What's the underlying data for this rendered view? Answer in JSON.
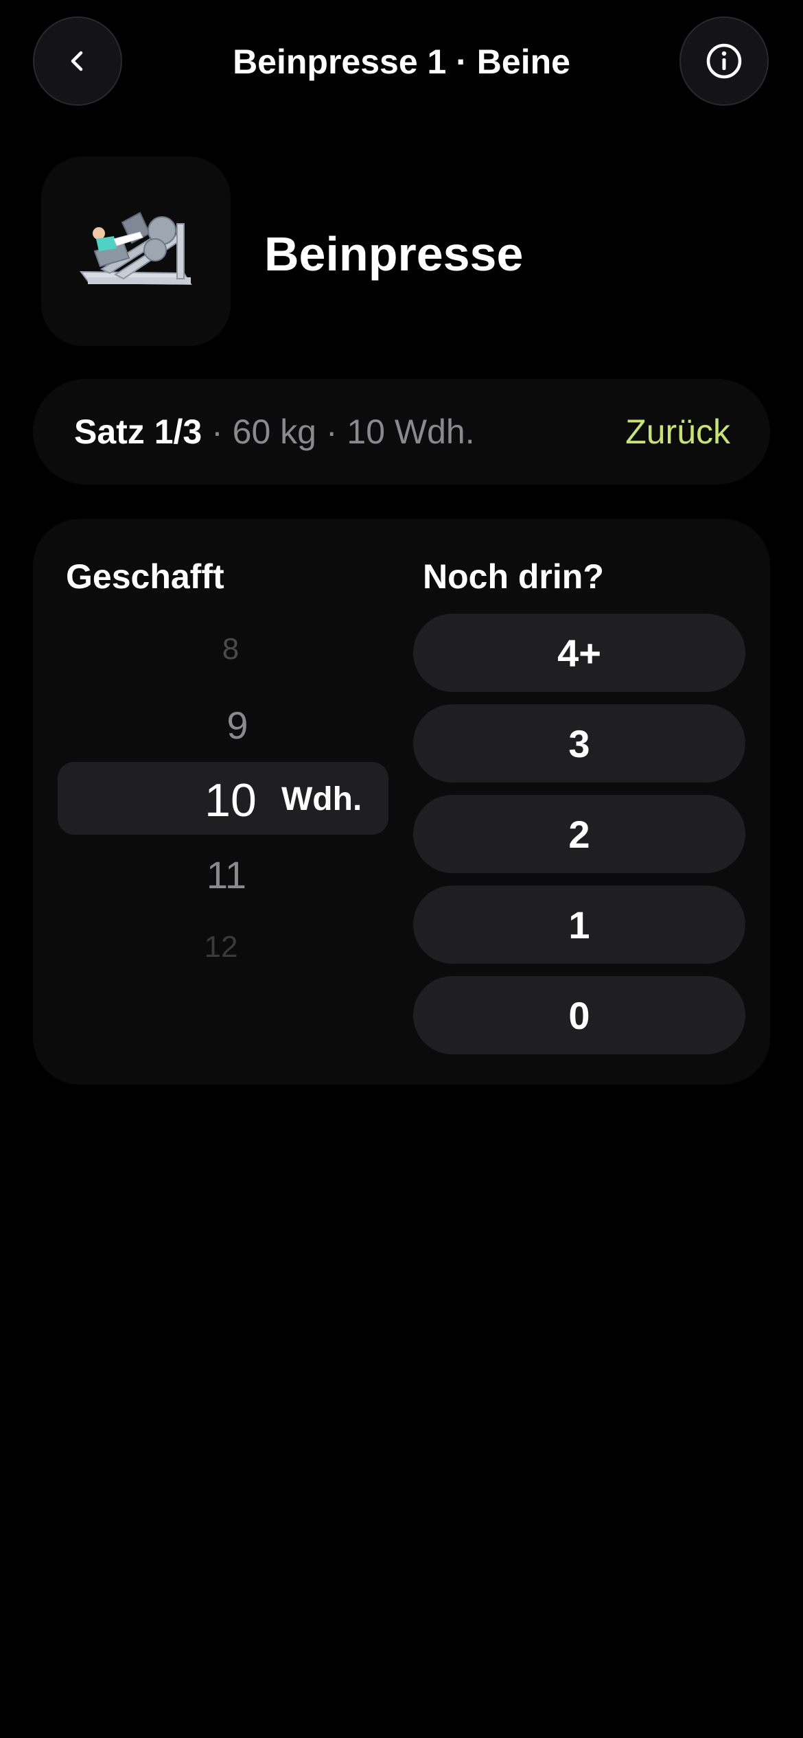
{
  "header": {
    "title": "Beinpresse 1 · Beine",
    "back_icon": "chevron-left-icon",
    "info_icon": "info-icon"
  },
  "exercise": {
    "name": "Beinpresse",
    "image": "leg-press-machine-icon"
  },
  "set_bar": {
    "set_label": "Satz 1/3",
    "details": " · 60 kg · 10 Wdh.",
    "back_label": "Zurück",
    "accent_color": "#c8e27a"
  },
  "completed": {
    "label": "Geschafft",
    "picker_values": [
      "8",
      "9",
      "10",
      "11",
      "12"
    ],
    "selected_value": "10",
    "unit": "Wdh."
  },
  "reps_in_reserve": {
    "label": "Noch drin?",
    "options": [
      "4+",
      "3",
      "2",
      "1",
      "0"
    ]
  }
}
